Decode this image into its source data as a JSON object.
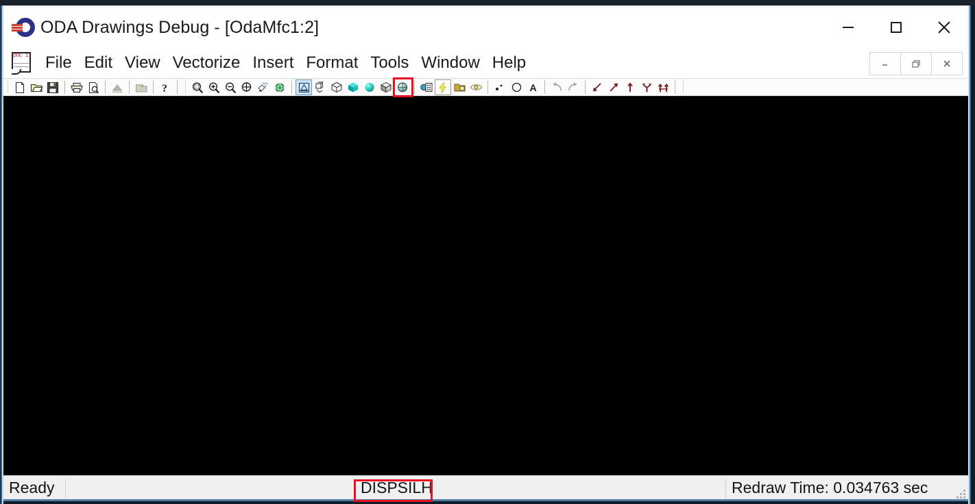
{
  "window": {
    "title": "ODA Drawings Debug - [OdaMfc1:2]",
    "logo_icon": "oda-logo-icon",
    "controls": [
      {
        "name": "minimize-button",
        "icon": "minimize-icon",
        "label": "—"
      },
      {
        "name": "maximize-button",
        "icon": "maximize-icon",
        "label": "□"
      },
      {
        "name": "close-button",
        "icon": "close-icon",
        "label": "✕"
      }
    ]
  },
  "menu": {
    "doc_icon": "document-icon",
    "doc_icon_label": "DOC 1",
    "items": [
      {
        "label": "File"
      },
      {
        "label": "Edit"
      },
      {
        "label": "View"
      },
      {
        "label": "Vectorize"
      },
      {
        "label": "Insert"
      },
      {
        "label": "Format"
      },
      {
        "label": "Tools"
      },
      {
        "label": "Window"
      },
      {
        "label": "Help"
      }
    ],
    "mdi_controls": [
      {
        "name": "mdi-minimize-button",
        "icon": "mdi-minimize-icon"
      },
      {
        "name": "mdi-restore-button",
        "icon": "mdi-restore-icon"
      },
      {
        "name": "mdi-close-button",
        "icon": "mdi-close-icon"
      }
    ]
  },
  "toolbar": {
    "groups": [
      {
        "name": "file-group",
        "buttons": [
          {
            "name": "new-button",
            "icon": "new-document-icon",
            "state": "normal"
          },
          {
            "name": "open-button",
            "icon": "open-folder-icon",
            "state": "normal"
          },
          {
            "name": "save-button",
            "icon": "save-floppy-icon",
            "state": "normal"
          }
        ]
      },
      {
        "name": "print-group",
        "buttons": [
          {
            "name": "print-button",
            "icon": "printer-icon",
            "state": "normal"
          },
          {
            "name": "print-preview-button",
            "icon": "print-preview-icon",
            "state": "normal"
          }
        ]
      },
      {
        "name": "render-group",
        "buttons": [
          {
            "name": "render-button",
            "icon": "render-icon",
            "state": "disabled"
          }
        ]
      },
      {
        "name": "import-group",
        "buttons": [
          {
            "name": "import-button",
            "icon": "import-folder-icon",
            "state": "disabled"
          }
        ]
      },
      {
        "name": "help-group",
        "buttons": [
          {
            "name": "help-button",
            "icon": "question-mark-icon",
            "state": "normal"
          }
        ]
      },
      {
        "name": "zoom-group",
        "buttons": [
          {
            "name": "zoom-window-button",
            "icon": "zoom-window-icon",
            "state": "normal"
          },
          {
            "name": "zoom-in-button",
            "icon": "zoom-in-icon",
            "state": "normal"
          },
          {
            "name": "zoom-out-button",
            "icon": "zoom-out-icon",
            "state": "normal"
          },
          {
            "name": "zoom-extents-button",
            "icon": "zoom-extents-icon",
            "state": "normal"
          },
          {
            "name": "pan-button",
            "icon": "pan-icon",
            "state": "normal"
          },
          {
            "name": "orbit-button",
            "icon": "orbit-globe-icon",
            "state": "normal"
          }
        ]
      },
      {
        "name": "visual-style-group",
        "buttons": [
          {
            "name": "wireframe-2d-button",
            "icon": "wireframe-2d-icon",
            "state": "selected"
          },
          {
            "name": "wireframe-3d-button",
            "icon": "wireframe-3d-icon",
            "state": "normal"
          },
          {
            "name": "hidden-line-button",
            "icon": "hidden-cube-icon",
            "state": "normal"
          },
          {
            "name": "flat-shaded-button",
            "icon": "flat-shaded-cube-icon",
            "state": "normal"
          },
          {
            "name": "gouraud-shaded-button",
            "icon": "gouraud-sphere-icon",
            "state": "normal"
          },
          {
            "name": "flat-shaded-edges-button",
            "icon": "flat-edges-cube-icon",
            "state": "normal"
          },
          {
            "name": "gouraud-shaded-edges-button",
            "icon": "gouraud-edges-sphere-icon",
            "state": "normal"
          }
        ]
      },
      {
        "name": "display-group",
        "buttons": [
          {
            "name": "material-button",
            "icon": "material-swatch-icon",
            "state": "normal"
          },
          {
            "name": "dispsilh-button",
            "icon": "lightning-bolt-icon",
            "state": "pressed",
            "annotated": true
          },
          {
            "name": "layer-button",
            "icon": "layer-icon",
            "state": "normal"
          },
          {
            "name": "visibility-button",
            "icon": "eye-icon",
            "state": "normal"
          }
        ]
      },
      {
        "name": "entity-group",
        "buttons": [
          {
            "name": "point-button",
            "icon": "points-icon",
            "state": "normal"
          },
          {
            "name": "circle-button",
            "icon": "circle-icon",
            "state": "normal"
          },
          {
            "name": "text-button",
            "icon": "text-a-icon",
            "state": "normal"
          }
        ]
      },
      {
        "name": "history-group",
        "buttons": [
          {
            "name": "undo-button",
            "icon": "undo-arrow-icon",
            "state": "disabled"
          },
          {
            "name": "redo-button",
            "icon": "redo-arrow-icon",
            "state": "disabled"
          }
        ]
      },
      {
        "name": "navigation-group",
        "buttons": [
          {
            "name": "step-back-button",
            "icon": "arrow-down-left-icon",
            "state": "normal"
          },
          {
            "name": "step-forward-button",
            "icon": "arrow-up-right-icon",
            "state": "normal"
          },
          {
            "name": "step-up-button",
            "icon": "arrow-up-icon",
            "state": "normal"
          },
          {
            "name": "branch-button",
            "icon": "branch-arrow-icon",
            "state": "normal"
          },
          {
            "name": "merge-button",
            "icon": "merge-arrow-icon",
            "state": "normal"
          }
        ]
      }
    ]
  },
  "canvas": {
    "background_color": "#000000"
  },
  "status_bar": {
    "ready_text": "Ready",
    "command_text": "DISPSILH",
    "redraw_text": "Redraw Time: 0.034763 sec",
    "resize_grip_icon": "resize-grip-icon"
  },
  "annotations": {
    "highlight_color": "#e81123",
    "toolbar_target": "dispsilh-button",
    "status_target": "status-command-text"
  }
}
